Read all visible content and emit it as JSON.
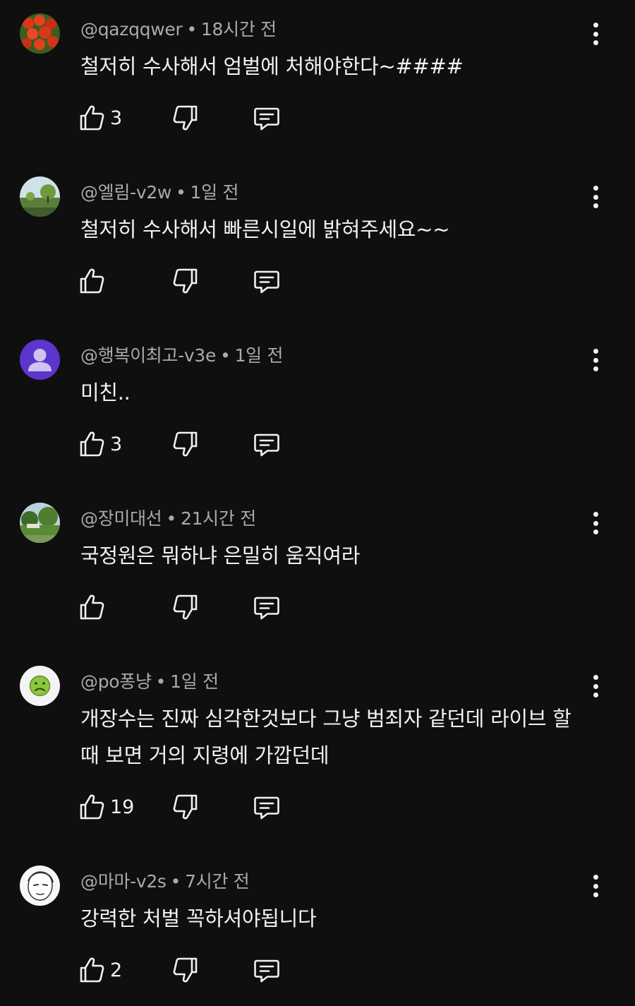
{
  "comments": [
    {
      "author": "@qazqqwer",
      "time": "18시간 전",
      "text": "철저히 수사해서 엄벌에 처해야한다~####",
      "likes": "3",
      "avatar": "tulips-photo"
    },
    {
      "author": "@엘림-v2w",
      "time": "1일 전",
      "text": "철저히  수사해서 빠른시일에 밝혀주세요~~",
      "likes": "",
      "avatar": "tree-park-photo"
    },
    {
      "author": "@행복이최고-v3e",
      "time": "1일 전",
      "text": "미친..",
      "likes": "3",
      "avatar": "default-person",
      "avatar_color": "#5c35cc"
    },
    {
      "author": "@장미대선",
      "time": "21시간 전",
      "text": "국정원은 뭐하냐 은밀히 움직여라",
      "likes": "",
      "avatar": "garden-photo"
    },
    {
      "author": "@po퐁냥",
      "time": "1일 전",
      "text": "개장수는 진짜 심각한것보다 그냥 범죄자 같던데 라이브 할때 보면 거의 지령에 가깝던데",
      "likes": "19",
      "avatar": "sick-face-emoji"
    },
    {
      "author": "@마마-v2s",
      "time": "7시간 전",
      "text": "강력한 처벌 꼭하셔야됩니다",
      "likes": "2",
      "avatar": "sketch-face"
    }
  ],
  "separator": "•",
  "icons": {
    "like": "thumb-up-icon",
    "dislike": "thumb-down-icon",
    "reply": "reply-icon",
    "menu": "more-vert-icon"
  },
  "colors": {
    "background": "#0f0f0f",
    "text": "#f1f1f1",
    "meta": "#aaaaaa"
  }
}
